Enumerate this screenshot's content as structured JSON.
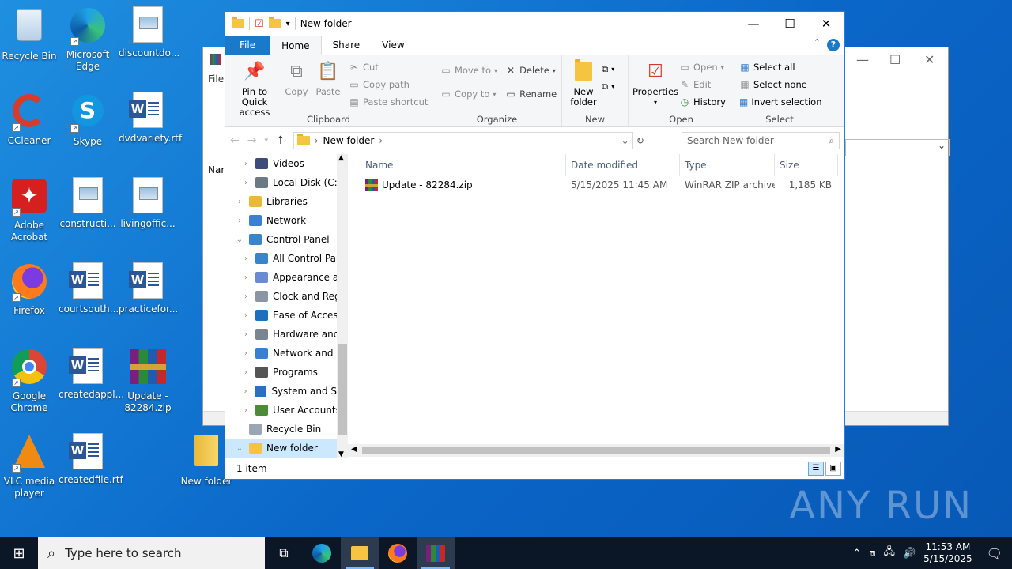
{
  "desktop": {
    "icons": [
      {
        "label": "Recycle Bin",
        "icon": "recycle-bin-icon"
      },
      {
        "label": "Microsoft Edge",
        "icon": "edge-icon"
      },
      {
        "label": "discountdo...",
        "icon": "image-file-icon"
      },
      {
        "label": "CCleaner",
        "icon": "ccleaner-icon"
      },
      {
        "label": "Skype",
        "icon": "skype-icon"
      },
      {
        "label": "dvdvariety.rtf",
        "icon": "word-document-icon"
      },
      {
        "label": "Adobe Acrobat",
        "icon": "acrobat-icon"
      },
      {
        "label": "constructi...",
        "icon": "image-file-icon"
      },
      {
        "label": "livingoffic...",
        "icon": "image-file-icon"
      },
      {
        "label": "Firefox",
        "icon": "firefox-icon"
      },
      {
        "label": "courtsouth...",
        "icon": "word-document-icon"
      },
      {
        "label": "practicefor...",
        "icon": "word-document-icon"
      },
      {
        "label": "Google Chrome",
        "icon": "chrome-icon"
      },
      {
        "label": "createdappl...",
        "icon": "word-document-icon"
      },
      {
        "label": "Update - 82284.zip",
        "icon": "winrar-archive-icon"
      },
      {
        "label": "VLC media player",
        "icon": "vlc-icon"
      },
      {
        "label": "createdfile.rtf",
        "icon": "word-document-icon"
      },
      {
        "label": "New folder",
        "icon": "folder-icon"
      }
    ]
  },
  "background_window": {
    "menu_label": "File",
    "column_label": "Nar"
  },
  "explorer": {
    "title": "New folder",
    "tabs": {
      "file": "File",
      "home": "Home",
      "share": "Share",
      "view": "View"
    },
    "ribbon": {
      "clipboard": {
        "label": "Clipboard",
        "pin": "Pin to Quick access",
        "copy": "Copy",
        "paste": "Paste",
        "cut": "Cut",
        "copy_path": "Copy path",
        "paste_shortcut": "Paste shortcut"
      },
      "organize": {
        "label": "Organize",
        "move_to": "Move to",
        "copy_to": "Copy to",
        "delete": "Delete",
        "rename": "Rename"
      },
      "new": {
        "label": "New",
        "new_folder": "New folder"
      },
      "open": {
        "label": "Open",
        "properties": "Properties",
        "open": "Open",
        "edit": "Edit",
        "history": "History"
      },
      "select": {
        "label": "Select",
        "select_all": "Select all",
        "select_none": "Select none",
        "invert": "Invert selection"
      }
    },
    "address": {
      "path": "New folder",
      "search_placeholder": "Search New folder"
    },
    "nav": [
      {
        "label": "Videos",
        "indent": 1,
        "color": "#3d4c7a"
      },
      {
        "label": "Local Disk (C:)",
        "indent": 1,
        "color": "#6c7a88"
      },
      {
        "label": "Libraries",
        "indent": 0,
        "color": "#e8b93a"
      },
      {
        "label": "Network",
        "indent": 0,
        "color": "#3a7fd1"
      },
      {
        "label": "Control Panel",
        "indent": 0,
        "color": "#3a84c9",
        "expanded": true
      },
      {
        "label": "All Control Par",
        "indent": 1,
        "color": "#3a84c9"
      },
      {
        "label": "Appearance an",
        "indent": 1,
        "color": "#6a8bd0"
      },
      {
        "label": "Clock and Regi",
        "indent": 1,
        "color": "#8a96a3"
      },
      {
        "label": "Ease of Access",
        "indent": 1,
        "color": "#1f6fc0"
      },
      {
        "label": "Hardware and",
        "indent": 1,
        "color": "#7a8592"
      },
      {
        "label": "Network and In",
        "indent": 1,
        "color": "#3a7fd1"
      },
      {
        "label": "Programs",
        "indent": 1,
        "color": "#555"
      },
      {
        "label": "System and Sec",
        "indent": 1,
        "color": "#2b6fc1"
      },
      {
        "label": "User Accounts",
        "indent": 1,
        "color": "#4d8a3a"
      },
      {
        "label": "Recycle Bin",
        "indent": 0,
        "color": "#9aa6b2"
      },
      {
        "label": "New folder",
        "indent": 0,
        "color": "#f5c542",
        "selected": true
      }
    ],
    "columns": {
      "name": "Name",
      "date": "Date modified",
      "type": "Type",
      "size": "Size"
    },
    "files": [
      {
        "name": "Update - 82284.zip",
        "date": "5/15/2025 11:45 AM",
        "type": "WinRAR ZIP archive",
        "size": "1,185 KB"
      }
    ],
    "status": "1 item"
  },
  "taskbar": {
    "search_placeholder": "Type here to search",
    "time": "11:53 AM",
    "date": "5/15/2025"
  },
  "watermark": "ANY RUN"
}
